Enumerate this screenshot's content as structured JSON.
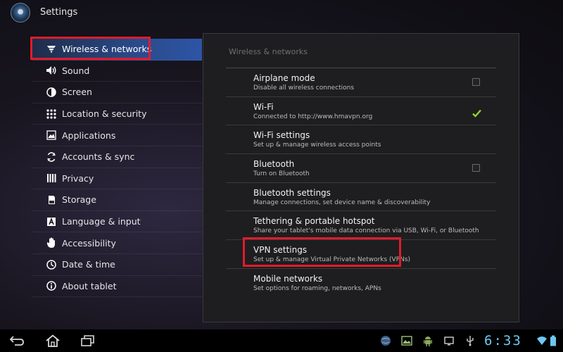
{
  "app": {
    "title": "Settings"
  },
  "sidebar": {
    "items": [
      {
        "label": "Wireless & networks",
        "icon": "wifi-icon",
        "selected": true
      },
      {
        "label": "Sound",
        "icon": "speaker-icon"
      },
      {
        "label": "Screen",
        "icon": "screen-icon"
      },
      {
        "label": "Location & security",
        "icon": "grid-icon"
      },
      {
        "label": "Applications",
        "icon": "applications-icon"
      },
      {
        "label": "Accounts & sync",
        "icon": "sync-icon"
      },
      {
        "label": "Privacy",
        "icon": "privacy-icon"
      },
      {
        "label": "Storage",
        "icon": "storage-icon"
      },
      {
        "label": "Language & input",
        "icon": "language-icon"
      },
      {
        "label": "Accessibility",
        "icon": "hand-icon"
      },
      {
        "label": "Date & time",
        "icon": "clock-icon"
      },
      {
        "label": "About tablet",
        "icon": "info-icon"
      }
    ]
  },
  "panel": {
    "heading": "Wireless & networks",
    "rows": [
      {
        "title": "Airplane mode",
        "summary": "Disable all wireless connections",
        "checkbox": true,
        "checked": false
      },
      {
        "title": "Wi-Fi",
        "summary": "Connected to http://www.hmavpn.org",
        "checkbox": true,
        "checked": true
      },
      {
        "title": "Wi-Fi settings",
        "summary": "Set up & manage wireless access points"
      },
      {
        "title": "Bluetooth",
        "summary": "Turn on Bluetooth",
        "checkbox": true,
        "checked": false
      },
      {
        "title": "Bluetooth settings",
        "summary": "Manage connections, set device name & discoverability"
      },
      {
        "title": "Tethering & portable hotspot",
        "summary": "Share your tablet's mobile data connection via USB, Wi-Fi, or Bluetooth"
      },
      {
        "title": "VPN settings",
        "summary": "Set up & manage Virtual Private Networks (VPNs)"
      },
      {
        "title": "Mobile networks",
        "summary": "Set options for roaming, networks, APNs"
      }
    ]
  },
  "statusbar": {
    "time": "6:33"
  },
  "colors": {
    "highlight": "#e21b2a",
    "selected": "#2d55a6",
    "check": "#8ed42b",
    "clock": "#6fc7f2"
  }
}
